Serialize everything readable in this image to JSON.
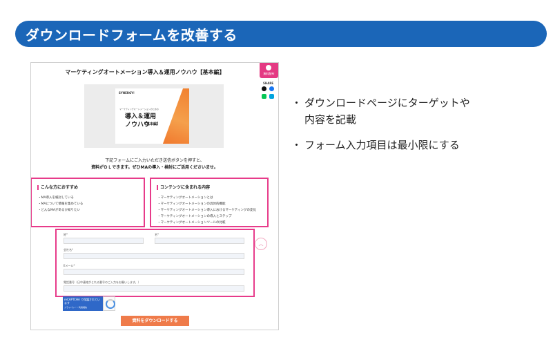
{
  "slide": {
    "title": "ダウンロードフォームを改善する",
    "bullets": [
      "ダウンロードページにターゲットや\n内容を記載",
      "フォーム入力項目は最小限にする"
    ]
  },
  "screenshot": {
    "page_title": "マーケティングオートメーション導入＆運用ノウハウ【基本編】",
    "badge_label": "無料配布",
    "share_label": "SHARE",
    "cover": {
      "logo": "SYNERGY!",
      "small_text": "マーケティングオートメーションのための",
      "big_line1": "導入＆運用",
      "big_line2": "ノウハウ",
      "tag": "【基本編】"
    },
    "intro_line1": "下記フォームにご入力いただき送信ボタンを押すと、",
    "intro_line2": "資料がＤＬできます。ぜひMAの導入・検討にご活用くださいませ。",
    "target": {
      "heading": "こんな方におすすめ",
      "items": [
        "・MA導入を検討している",
        "・MAについて情報を集めている",
        "・どんなMAがあるか知りたい"
      ]
    },
    "contents": {
      "heading": "コンテンツに含まれる内容",
      "items": [
        "・マーケティングオートメーションとは",
        "・マーケティングオートメーションの具体的機能",
        "・マーケティングオートメーション導入におけるマーケティングの変化",
        "・マーケティングオートメーションの導入とステップ",
        "・マーケティングオートメーションツールの比較"
      ]
    },
    "form": {
      "last_name_label": "姓*",
      "first_name_label": "名*",
      "company_label": "会社名*",
      "email_label": "Eメール*",
      "phone_label": "電話番号（日中連絡がとれる番号のご入力をお願いします。）",
      "recaptcha_text": "reCAPTCHA で保護されています",
      "recaptcha_sub": "プライバシー・利用規約",
      "submit_label": "資料をダウンロードする"
    },
    "up_icon": "︿"
  }
}
